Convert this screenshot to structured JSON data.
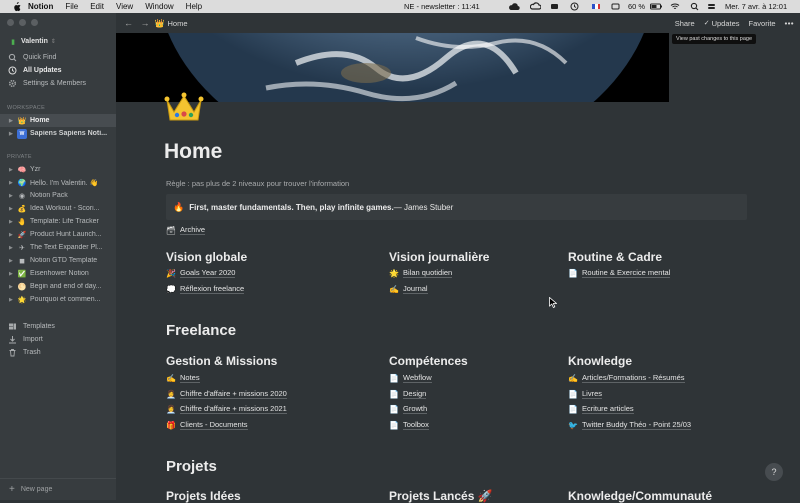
{
  "menubar": {
    "app_name": "Notion",
    "items": [
      "File",
      "Edit",
      "View",
      "Window",
      "Help"
    ],
    "status_text": "NE - newsletter : 11:41",
    "battery": "60 %",
    "datetime": "Mer. 7 avr. à  12:01"
  },
  "sidebar": {
    "workspace_name": "Valentin",
    "top_items": [
      "Quick Find",
      "All Updates",
      "Settings & Members"
    ],
    "workspace_label": "WORKSPACE",
    "workspace_items": [
      {
        "label": "Home",
        "icon": "👑"
      },
      {
        "label": "Sapiens Sapiens Noti...",
        "icon": "W"
      }
    ],
    "private_label": "PRIVATE",
    "private_items": [
      {
        "label": "Yzr",
        "icon": "🧠"
      },
      {
        "label": "Hello. I'm Valentin. 👋",
        "icon": "🌍"
      },
      {
        "label": "Notion Pack",
        "icon": "◉"
      },
      {
        "label": "Idea Workout - Scori...",
        "icon": "💰"
      },
      {
        "label": "Template: Life Tracker",
        "icon": "🤚"
      },
      {
        "label": "Product Hunt Launch...",
        "icon": "🚀"
      },
      {
        "label": "The Text Expander Pl...",
        "icon": "✈"
      },
      {
        "label": "Notion GTD Template",
        "icon": "◼"
      },
      {
        "label": "Eisenhower Notion",
        "icon": "✅"
      },
      {
        "label": "Begin and end of day...",
        "icon": "🌕"
      },
      {
        "label": "Pourquoi et commen...",
        "icon": "🌟"
      }
    ],
    "bottom_items": [
      "Templates",
      "Import",
      "Trash"
    ],
    "new_page": "New page"
  },
  "topbar": {
    "breadcrumb": "Home",
    "share": "Share",
    "updates": "Updates",
    "favorite": "Favorite",
    "tooltip": "View past changes to this page"
  },
  "page": {
    "title": "Home",
    "rule": "Règle : pas plus de 2 niveaux pour trouver l'information",
    "callout_bold": "First, master fundamentals. Then, play infinite games.",
    "callout_rest": " — James Stuber",
    "archive": "Archive",
    "section_vision": [
      {
        "heading": "Vision globale",
        "links": [
          {
            "icon": "🎉",
            "label": "Goals Year 2020"
          },
          {
            "icon": "💭",
            "label": "Réflexion freelance"
          }
        ]
      },
      {
        "heading": "Vision journalière",
        "links": [
          {
            "icon": "🌟",
            "label": "Bilan quotidien"
          },
          {
            "icon": "✍",
            "label": "Journal"
          }
        ]
      },
      {
        "heading": "Routine & Cadre",
        "links": [
          {
            "icon": "📄",
            "label": "Routine & Exercice mental"
          }
        ]
      }
    ],
    "freelance_heading": "Freelance",
    "section_freelance": [
      {
        "heading": "Gestion & Missions",
        "links": [
          {
            "icon": "✍",
            "label": "Notes"
          },
          {
            "icon": "👩‍💼",
            "label": "Chiffre d'affaire + missions 2020"
          },
          {
            "icon": "👩‍💼",
            "label": "Chiffre d'affaire + missions 2021"
          },
          {
            "icon": "🎁",
            "label": "Clients - Documents"
          }
        ]
      },
      {
        "heading": "Compétences",
        "links": [
          {
            "icon": "📄",
            "label": "Webflow"
          },
          {
            "icon": "📄",
            "label": "Design"
          },
          {
            "icon": "📄",
            "label": "Growth"
          },
          {
            "icon": "📄",
            "label": "Toolbox"
          }
        ]
      },
      {
        "heading": "Knowledge",
        "links": [
          {
            "icon": "✍",
            "label": "Articles/Formations - Résumés"
          },
          {
            "icon": "📄",
            "label": "Livres"
          },
          {
            "icon": "📄",
            "label": "Ecriture articles"
          },
          {
            "icon": "🐦",
            "label": "Twitter Buddy Théo - Point 25/03"
          }
        ]
      }
    ],
    "projets_heading": "Projets",
    "section_projets": [
      "Projets Idées",
      "Projets Lancés 🚀",
      "Knowledge/Communauté"
    ]
  },
  "help": "?"
}
